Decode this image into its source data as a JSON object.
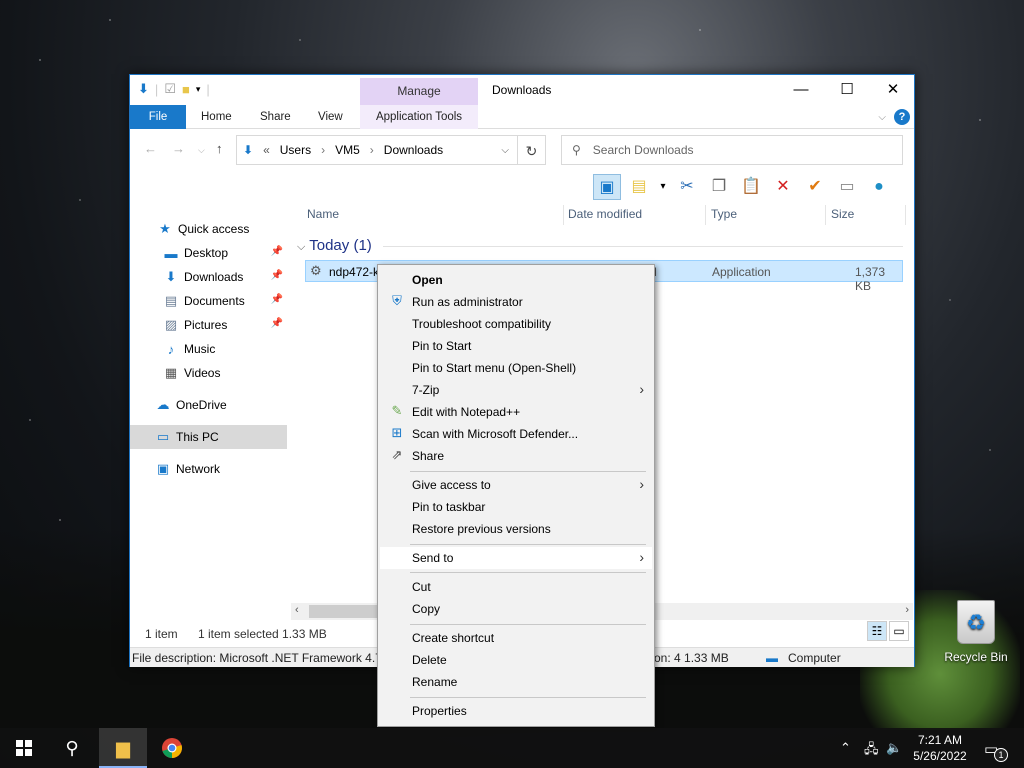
{
  "window": {
    "title": "Downloads",
    "manage_tab": "Manage",
    "ribbon_tabs": [
      "File",
      "Home",
      "Share",
      "View",
      "Application Tools"
    ],
    "controls": {
      "minimize": "—",
      "maximize": "☐",
      "close": "✕"
    }
  },
  "address": {
    "prefix": "«",
    "breadcrumb": [
      "Users",
      "VM5",
      "Downloads"
    ]
  },
  "search": {
    "placeholder": "Search Downloads"
  },
  "sidebar": {
    "items": [
      {
        "label": "Quick access",
        "icon": "star-icon"
      },
      {
        "label": "Desktop",
        "icon": "desktop-icon",
        "pinned": true
      },
      {
        "label": "Downloads",
        "icon": "downloads-icon",
        "pinned": true
      },
      {
        "label": "Documents",
        "icon": "documents-icon",
        "pinned": true
      },
      {
        "label": "Pictures",
        "icon": "pictures-icon",
        "pinned": true
      },
      {
        "label": "Music",
        "icon": "music-icon"
      },
      {
        "label": "Videos",
        "icon": "videos-icon"
      },
      {
        "label": "OneDrive",
        "icon": "cloud-icon"
      },
      {
        "label": "This PC",
        "icon": "pc-icon",
        "selected": true
      },
      {
        "label": "Network",
        "icon": "network-icon"
      }
    ]
  },
  "columns": [
    "Name",
    "Date modified",
    "Type",
    "Size"
  ],
  "group_label": "Today (1)",
  "file": {
    "name": "ndp472-k",
    "date_fragment": "M",
    "type": "Application",
    "size": "1,373 KB"
  },
  "status": {
    "items": "1 item",
    "selected": "1 item selected  1.33 MB",
    "description": "File description: Microsoft .NET Framework 4.7",
    "size_fragment": "on: 4  1.33 MB",
    "location": "Computer"
  },
  "context_menu": {
    "items": [
      {
        "label": "Open",
        "bold": true
      },
      {
        "label": "Run as administrator",
        "icon": "shield-icon"
      },
      {
        "label": "Troubleshoot compatibility"
      },
      {
        "label": "Pin to Start"
      },
      {
        "label": "Pin to Start menu (Open-Shell)"
      },
      {
        "label": "7-Zip",
        "submenu": true
      },
      {
        "label": "Edit with Notepad++",
        "icon": "notepad-icon"
      },
      {
        "label": "Scan with Microsoft Defender...",
        "icon": "defender-icon"
      },
      {
        "label": "Share",
        "icon": "share-icon"
      },
      {
        "label": "Give access to",
        "submenu": true
      },
      {
        "label": "Pin to taskbar"
      },
      {
        "label": "Restore previous versions"
      },
      {
        "label": "Send to",
        "submenu": true,
        "hover": true
      },
      {
        "label": "Cut"
      },
      {
        "label": "Copy"
      },
      {
        "label": "Create shortcut"
      },
      {
        "label": "Delete"
      },
      {
        "label": "Rename"
      },
      {
        "label": "Properties"
      }
    ]
  },
  "desktop": {
    "recycle_bin": "Recycle Bin"
  },
  "taskbar": {
    "time": "7:21 AM",
    "date": "5/26/2022",
    "notifications": "1"
  }
}
